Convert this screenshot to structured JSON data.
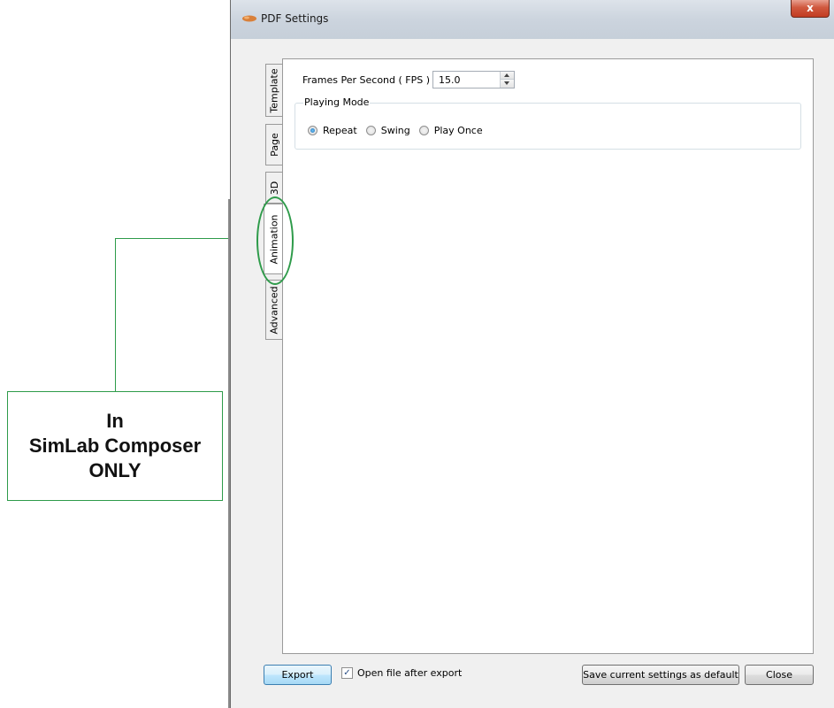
{
  "window": {
    "title": "PDF Settings",
    "close_glyph": "x"
  },
  "tabs": [
    {
      "label": "Template",
      "active": false
    },
    {
      "label": "Page",
      "active": false
    },
    {
      "label": "3D",
      "active": false
    },
    {
      "label": "Animation",
      "active": true
    },
    {
      "label": "Advanced",
      "active": false
    }
  ],
  "animation": {
    "fps_label": "Frames Per Second ( FPS )",
    "fps_value": "15.0",
    "playing_mode_title": "Playing Mode",
    "modes": [
      {
        "label": "Repeat",
        "checked": true
      },
      {
        "label": "Swing",
        "checked": false
      },
      {
        "label": "Play Once",
        "checked": false
      }
    ]
  },
  "footer": {
    "export_label": "Export",
    "open_after_export_label": "Open file after export",
    "open_after_export_checked": true,
    "save_default_label": "Save current settings as default",
    "close_label": "Close"
  },
  "annotation": {
    "line1": "In",
    "line2": "SimLab Composer",
    "line3": "ONLY"
  },
  "colors": {
    "annotation_green": "#2e9b4a",
    "radio_checked": "#1f6fb8"
  }
}
